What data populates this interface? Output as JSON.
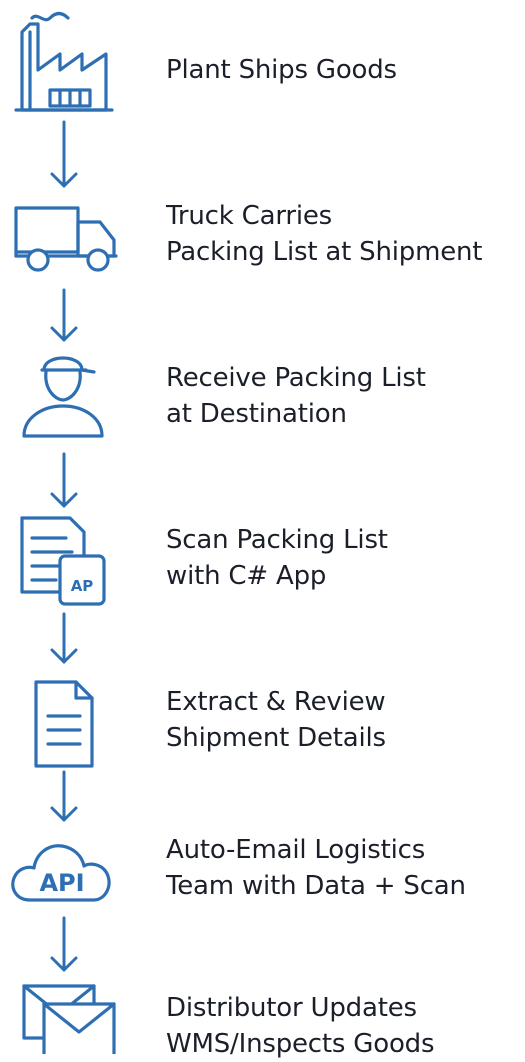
{
  "colors": {
    "icon_stroke": "#2e6fb3",
    "text": "#1b1f2a",
    "background": "#ffffff"
  },
  "steps": [
    {
      "icon": "factory-icon",
      "label": "Plant Ships Goods"
    },
    {
      "icon": "truck-icon",
      "label": "Truck Carries\nPacking List at Shipment"
    },
    {
      "icon": "person-cap-icon",
      "label": "Receive Packing List\nat Destination"
    },
    {
      "icon": "document-app-icon",
      "label": "Scan Packing List\nwith C# App",
      "badge": "AP"
    },
    {
      "icon": "document-icon",
      "label": "Extract & Review\nShipment Details"
    },
    {
      "icon": "cloud-api-icon",
      "label": "Auto-Email Logistics\nTeam with Data + Scan",
      "badge": "API"
    },
    {
      "icon": "envelopes-icon",
      "label": "Distributor Updates\nWMS/Inspects Goods"
    }
  ]
}
